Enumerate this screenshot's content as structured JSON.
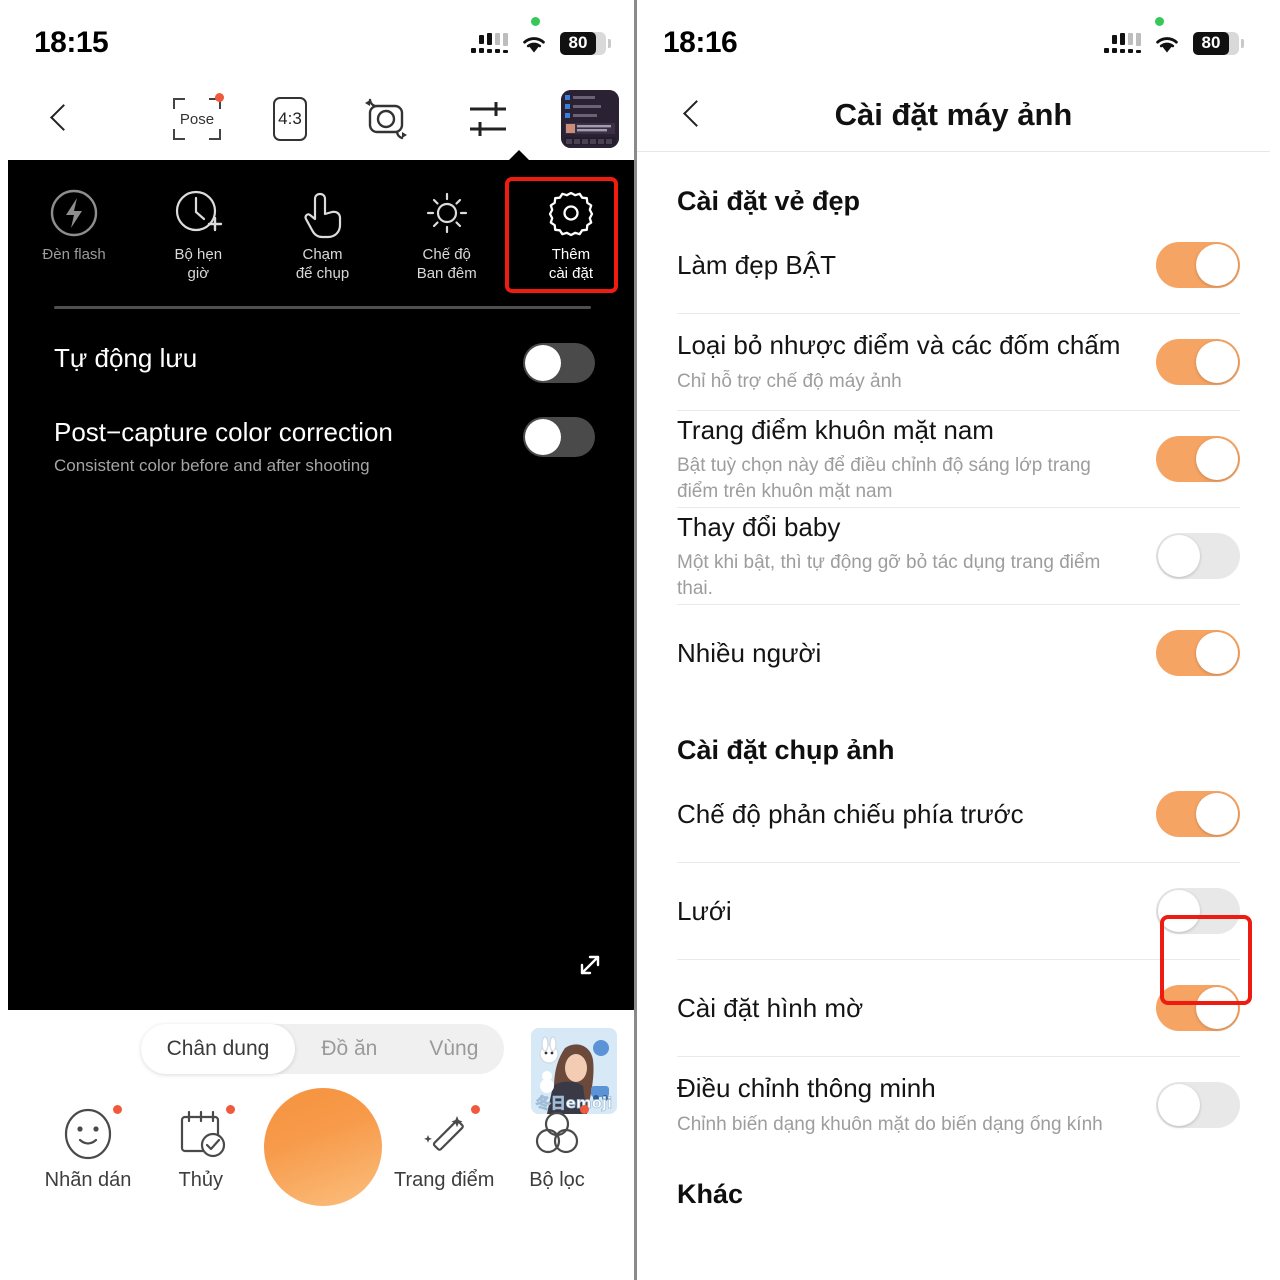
{
  "left": {
    "status": {
      "time": "18:15",
      "battery": "80"
    },
    "toolbar": {
      "back": "back-chevron",
      "pose_label": "Pose",
      "ratio_label": "4:3",
      "flip_label": "flip-camera",
      "adjust_label": "adjust-sliders",
      "thumb_label": "recent-capture"
    },
    "quick_settings": [
      {
        "label_line1": "Đèn flash",
        "label_line2": "",
        "icon": "flash-icon"
      },
      {
        "label_line1": "Bộ hẹn",
        "label_line2": "giờ",
        "icon": "timer-icon"
      },
      {
        "label_line1": "Chạm",
        "label_line2": "để chụp",
        "icon": "touch-capture-icon"
      },
      {
        "label_line1": "Chế độ",
        "label_line2": "Ban đêm",
        "icon": "night-mode-icon"
      },
      {
        "label_line1": "Thêm",
        "label_line2": "cài đặt",
        "icon": "gear-icon"
      }
    ],
    "rows": [
      {
        "title": "Tự động lưu",
        "subtitle": "",
        "state": "off"
      },
      {
        "title": "Post−capture color correction",
        "subtitle": "Consistent color before and after shooting",
        "state": "off"
      }
    ],
    "modes": [
      {
        "label": "Chân dung",
        "active": true
      },
      {
        "label": "Đồ ăn",
        "active": false
      },
      {
        "label": "Vùng",
        "active": false
      }
    ],
    "sticker_caption": "冬日emoji",
    "actions": [
      {
        "label": "Nhãn dán",
        "icon": "smiley-sticker-icon",
        "badge": true
      },
      {
        "label": "Thủy",
        "icon": "calendar-check-icon",
        "badge": true
      },
      {
        "label": "",
        "icon": "shutter-button",
        "badge": false
      },
      {
        "label": "Trang điểm",
        "icon": "magic-wand-icon",
        "badge": true
      },
      {
        "label": "Bộ lọc",
        "icon": "filter-circles-icon",
        "badge": true
      }
    ]
  },
  "right": {
    "status": {
      "time": "18:16",
      "battery": "80"
    },
    "header": {
      "title": "Cài đặt máy ảnh",
      "back": "back-chevron"
    },
    "sections": [
      {
        "heading": "Cài đặt vẻ đẹp",
        "items": [
          {
            "title": "Làm đẹp BẬT",
            "subtitle": "",
            "state": "on",
            "sep": true,
            "highlight": false
          },
          {
            "title": "Loại bỏ nhược điểm và các đốm chấm",
            "subtitle": "Chỉ hỗ trợ chế độ máy ảnh",
            "state": "on",
            "sep": true,
            "highlight": false
          },
          {
            "title": "Trang điểm khuôn mặt nam",
            "subtitle": "Bật tuỳ chọn này để điều chỉnh độ sáng lớp trang điểm trên khuôn mặt nam",
            "state": "on",
            "sep": true,
            "highlight": false
          },
          {
            "title": "Thay đổi baby",
            "subtitle": "Một khi bật, thì tự động gỡ bỏ tác dụng trang điểm thai.",
            "state": "off",
            "sep": true,
            "highlight": false
          },
          {
            "title": "Nhiều người",
            "subtitle": "",
            "state": "on",
            "sep": false,
            "highlight": false
          }
        ]
      },
      {
        "heading": "Cài đặt chụp ảnh",
        "items": [
          {
            "title": "Chế độ phản chiếu phía trước",
            "subtitle": "",
            "state": "on",
            "sep": true,
            "highlight": false
          },
          {
            "title": "Lưới",
            "subtitle": "",
            "state": "off",
            "sep": true,
            "highlight": false
          },
          {
            "title": "Cài đặt hình mờ",
            "subtitle": "",
            "state": "on",
            "sep": true,
            "highlight": true
          },
          {
            "title": "Điều chỉnh thông minh",
            "subtitle": "Chỉnh biến dạng khuôn mặt do biến dạng ống kính",
            "state": "off",
            "sep": false,
            "highlight": false
          }
        ]
      },
      {
        "heading": "Khác",
        "items": []
      }
    ]
  },
  "colors": {
    "accent": "#f6a463",
    "highlight": "#ee1b10",
    "shutter": "#f6933f",
    "badge": "#f05a3c"
  }
}
